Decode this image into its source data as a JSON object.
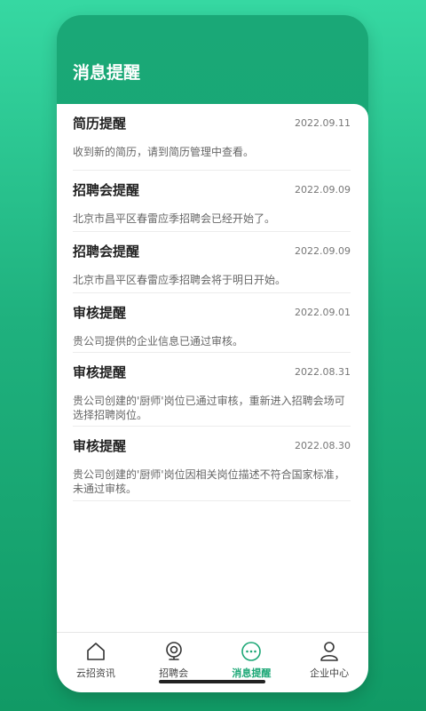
{
  "header": {
    "title": "消息提醒"
  },
  "messages": [
    {
      "title": "简历提醒",
      "date": "2022.09.11",
      "body": "收到新的简历，请到简历管理中查看。"
    },
    {
      "title": "招聘会提醒",
      "date": "2022.09.09",
      "body": "北京市昌平区春雷应季招聘会已经开始了。"
    },
    {
      "title": "招聘会提醒",
      "date": "2022.09.09",
      "body": "北京市昌平区春雷应季招聘会将于明日开始。"
    },
    {
      "title": "审核提醒",
      "date": "2022.09.01",
      "body": "贵公司提供的企业信息已通过审核。"
    },
    {
      "title": "审核提醒",
      "date": "2022.08.31",
      "body": "贵公司创建的'厨师'岗位已通过审核，重新进入招聘会场可选择招聘岗位。"
    },
    {
      "title": "审核提醒",
      "date": "2022.08.30",
      "body": "贵公司创建的'厨师'岗位因相关岗位描述不符合国家标准，未通过审核。"
    }
  ],
  "tabs": [
    {
      "label": "云招资讯",
      "icon": "home-icon"
    },
    {
      "label": "招聘会",
      "icon": "camera-icon"
    },
    {
      "label": "消息提醒",
      "icon": "message-icon",
      "active": true
    },
    {
      "label": "企业中心",
      "icon": "user-icon"
    }
  ],
  "colors": {
    "accent": "#1ca776",
    "header": "#13a36f"
  }
}
